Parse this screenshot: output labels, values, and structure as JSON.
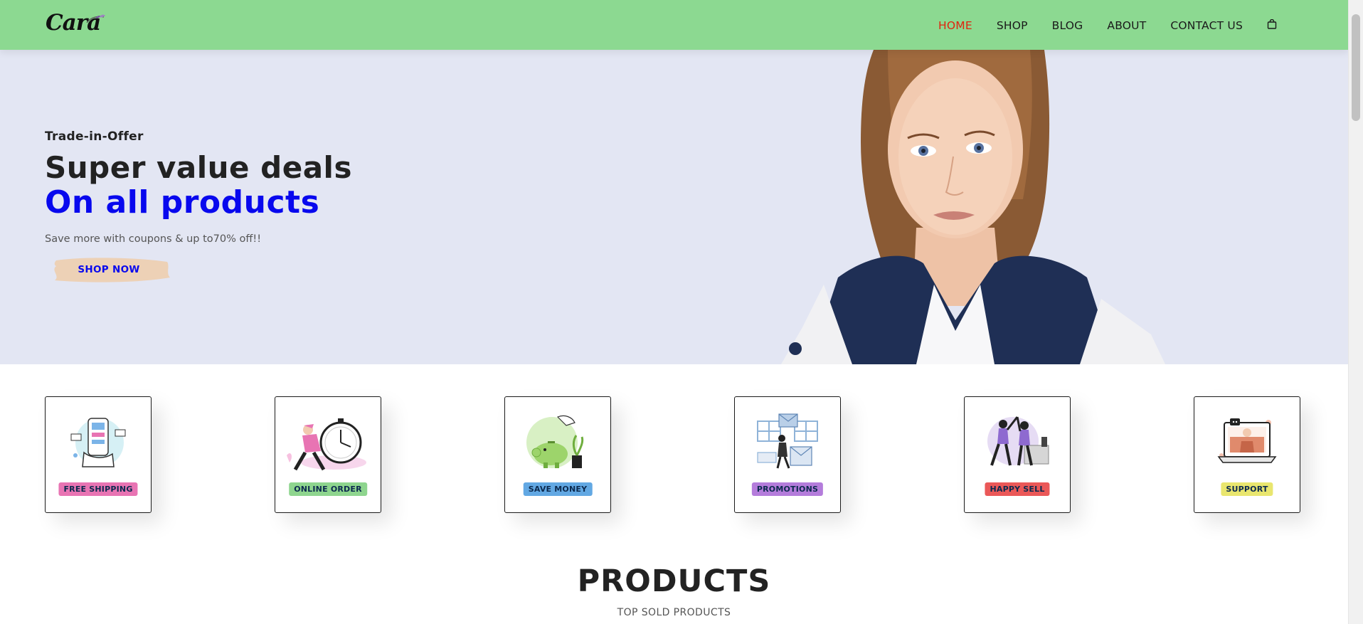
{
  "header": {
    "logo_text": "Cara",
    "nav": [
      {
        "label": "HOME",
        "active": true
      },
      {
        "label": "SHOP",
        "active": false
      },
      {
        "label": "BLOG",
        "active": false
      },
      {
        "label": "ABOUT",
        "active": false
      },
      {
        "label": "CONTACT US",
        "active": false
      }
    ],
    "cart_icon": "shopping-bag-icon"
  },
  "hero": {
    "kicker": "Trade-in-Offer",
    "headline": "Super value deals",
    "subheadline": "On all products",
    "description": "Save more with coupons & up to70% off!!",
    "button_label": "SHOP NOW",
    "image": "model-portrait"
  },
  "features": [
    {
      "label": "FREE SHIPPING",
      "color": "#e874b3",
      "icon": "free-shipping-icon"
    },
    {
      "label": "ONLINE ORDER",
      "color": "#8ed58e",
      "icon": "online-order-icon"
    },
    {
      "label": "SAVE MONEY",
      "color": "#62a8e3",
      "icon": "save-money-icon"
    },
    {
      "label": "PROMOTIONS",
      "color": "#b47cdb",
      "icon": "promotions-icon"
    },
    {
      "label": "HAPPY SELL",
      "color": "#ea5858",
      "icon": "happy-sell-icon"
    },
    {
      "label": "SUPPORT",
      "color": "#e9e66f",
      "icon": "support-icon"
    }
  ],
  "products": {
    "title": "PRODUCTS",
    "subtitle": "TOP SOLD PRODUCTS"
  },
  "colors": {
    "header_bg": "#8cd991",
    "hero_bg": "#e3e6f3",
    "accent_blue": "#0808ee",
    "active_nav": "#e0240e"
  }
}
